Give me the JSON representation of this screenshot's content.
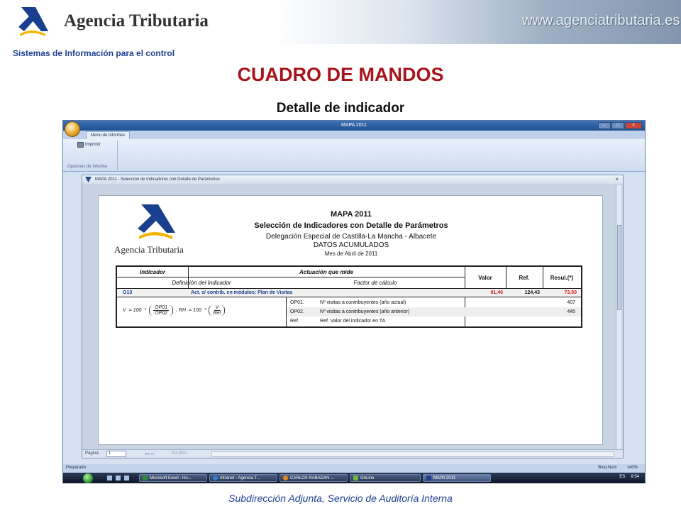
{
  "banner": {
    "agency_name": "Agencia Tributaria",
    "website": "www.agenciatributaria.es"
  },
  "page": {
    "system_title": "Sistemas de Información para el control",
    "main_title": "CUADRO DE MANDOS",
    "subtitle": "Detalle de indicador",
    "footer": "Subdirección Adjunta, Servicio de Auditoría Interna"
  },
  "app": {
    "title": "MAPA 2011",
    "ribbon_tab": "Menu de informes",
    "print_button": "Imprimir",
    "ribbon_group": "Opciones de Informe",
    "viewer_title": "MAPA 2011 - Selección de Indicadores con Detalle de Parámetros",
    "viewer_close": "×"
  },
  "report": {
    "agency": "Agencia Tributaria",
    "title": "MAPA 2011",
    "heading": "Selección de Indicadores con Detalle de Parámetros",
    "delegation": "Delegación Especial de Castilla-La Mancha - Albacete",
    "data_type": "DATOS ACUMULADOS",
    "period": "Mes de Abril de 2011",
    "headers": {
      "indicador": "Indicador",
      "actuacion": "Actuación que mide",
      "definicion": "Definición del Indicador",
      "factor": "Factor de cálculo",
      "valor": "Valor",
      "ref": "Ref.",
      "resul": "Resul.(*)"
    },
    "indicator": {
      "code": "G13",
      "action": "Act. s/ contrib. en módulos: Plan de Visitas",
      "valor": "91,46",
      "ref": "124,43",
      "resul": "73,50"
    },
    "formula": {
      "v_label": "V",
      "equals_100": "= 100",
      "times": "*",
      "op01": "OP01",
      "op02": "OP02",
      "rh_label": "; RH",
      "v_num": "V",
      "ref_den": "Ref"
    },
    "params": [
      {
        "code": "OP01.",
        "desc": "Nº visitas a contribuyentes (año actual)",
        "value": "407"
      },
      {
        "code": "OP02.",
        "desc": "Nº visitas a contribuyentes (año anterior)",
        "value": "445"
      },
      {
        "code": "Ref.",
        "desc": "Ref. Valor del indicador en TA",
        "value": ""
      }
    ]
  },
  "pager": {
    "label": "Página:",
    "value": "1",
    "filter": "Sin filtro"
  },
  "status": {
    "left": "Preparado",
    "numlock": "Bloq Num",
    "zoom": "140%"
  },
  "taskbar": {
    "tasks": [
      "Microsoft Excel - Ho...",
      "Intranet - Agencia T...",
      "CARLOS RABADAN ...",
      "OnLine",
      "MAPA 2011"
    ],
    "lang": "ES",
    "time": "8:54"
  },
  "colors": {
    "title_red": "#a8141c",
    "link_blue": "#1b3f8f",
    "value_red": "#d61e1e"
  }
}
